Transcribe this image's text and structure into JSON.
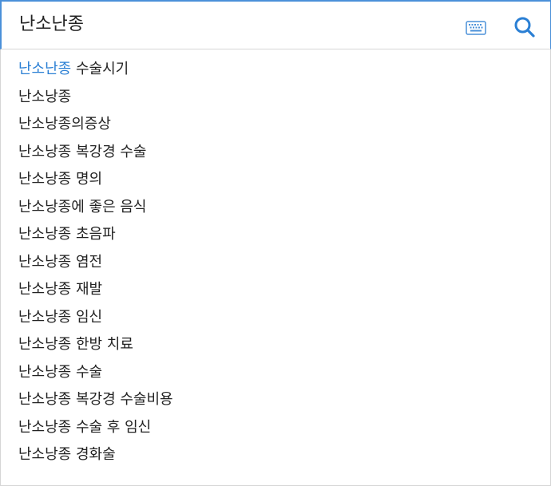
{
  "search": {
    "query": "난소난종",
    "placeholder": ""
  },
  "icons": {
    "keyboard": "keyboard-icon",
    "search": "search-icon"
  },
  "colors": {
    "accent": "#2a7fd4",
    "border_focus": "#4a90d9",
    "text": "#222222"
  },
  "suggestions": [
    {
      "match": "난소난종",
      "rest": " 수술시기"
    },
    {
      "match": "",
      "rest": "난소낭종"
    },
    {
      "match": "",
      "rest": "난소낭종의증상"
    },
    {
      "match": "",
      "rest": "난소낭종 복강경 수술"
    },
    {
      "match": "",
      "rest": "난소낭종 명의"
    },
    {
      "match": "",
      "rest": "난소낭종에 좋은 음식"
    },
    {
      "match": "",
      "rest": "난소낭종 초음파"
    },
    {
      "match": "",
      "rest": "난소낭종 염전"
    },
    {
      "match": "",
      "rest": "난소낭종 재발"
    },
    {
      "match": "",
      "rest": "난소낭종 임신"
    },
    {
      "match": "",
      "rest": "난소낭종 한방 치료"
    },
    {
      "match": "",
      "rest": "난소낭종 수술"
    },
    {
      "match": "",
      "rest": "난소낭종 복강경 수술비용"
    },
    {
      "match": "",
      "rest": "난소낭종 수술 후 임신"
    },
    {
      "match": "",
      "rest": "난소낭종 경화술"
    }
  ]
}
